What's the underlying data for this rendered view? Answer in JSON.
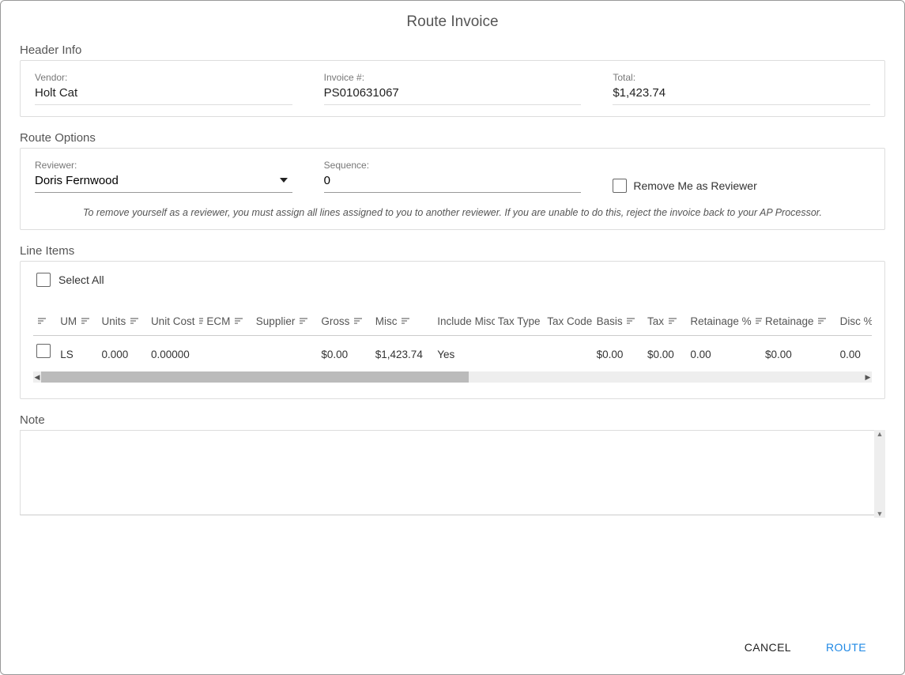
{
  "dialog": {
    "title": "Route Invoice"
  },
  "header": {
    "section_title": "Header Info",
    "vendor_label": "Vendor:",
    "vendor_value": "Holt Cat",
    "invoice_label": "Invoice #:",
    "invoice_value": "PS010631067",
    "total_label": "Total:",
    "total_value": "$1,423.74"
  },
  "route": {
    "section_title": "Route Options",
    "reviewer_label": "Reviewer:",
    "reviewer_value": "Doris Fernwood",
    "sequence_label": "Sequence:",
    "sequence_value": "0",
    "remove_me_label": "Remove Me as Reviewer",
    "instruction": "To remove yourself as a reviewer, you must assign all lines assigned to you to another reviewer. If you are unable to do this, reject the invoice back to your AP Processor."
  },
  "line_items": {
    "section_title": "Line Items",
    "select_all_label": "Select All",
    "columns": {
      "um": "UM",
      "units": "Units",
      "unit_cost": "Unit Cost",
      "ecm": "ECM",
      "supplier": "Supplier",
      "gross": "Gross",
      "misc": "Misc",
      "include_misc": "Include Misc",
      "tax_type": "Tax Type",
      "tax_code": "Tax Code",
      "basis": "Basis",
      "tax": "Tax",
      "retainage_pct": "Retainage %",
      "retainage": "Retainage",
      "disc_pct": "Disc %"
    },
    "rows": [
      {
        "um": "LS",
        "units": "0.000",
        "unit_cost": "0.00000",
        "ecm": "",
        "supplier": "",
        "gross": "$0.00",
        "misc": "$1,423.74",
        "include_misc": "Yes",
        "tax_type": "",
        "tax_code": "",
        "basis": "$0.00",
        "tax": "$0.00",
        "retainage_pct": "0.00",
        "retainage": "$0.00",
        "disc_pct": "0.00"
      }
    ]
  },
  "note": {
    "section_title": "Note",
    "value": ""
  },
  "actions": {
    "cancel": "CANCEL",
    "route": "ROUTE"
  }
}
